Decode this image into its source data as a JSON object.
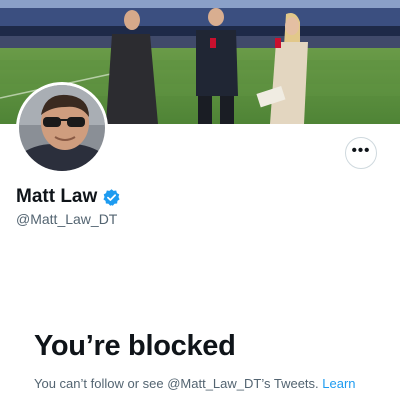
{
  "profile": {
    "display_name": "Matt Law",
    "handle": "@Matt_Law_DT",
    "verified_icon": "verified-badge-icon",
    "more_button_label": "•••",
    "banner": "pitchside photo",
    "avatar": "profile photo"
  },
  "blocked": {
    "title": "You’re blocked",
    "message": "You can’t follow or see @Matt_Law_DT’s Tweets.",
    "learn_more": "Learn more"
  },
  "colors": {
    "accent": "#1d9bf0",
    "text_primary": "#0f1419",
    "text_secondary": "#536471",
    "border": "#cfd9de"
  }
}
